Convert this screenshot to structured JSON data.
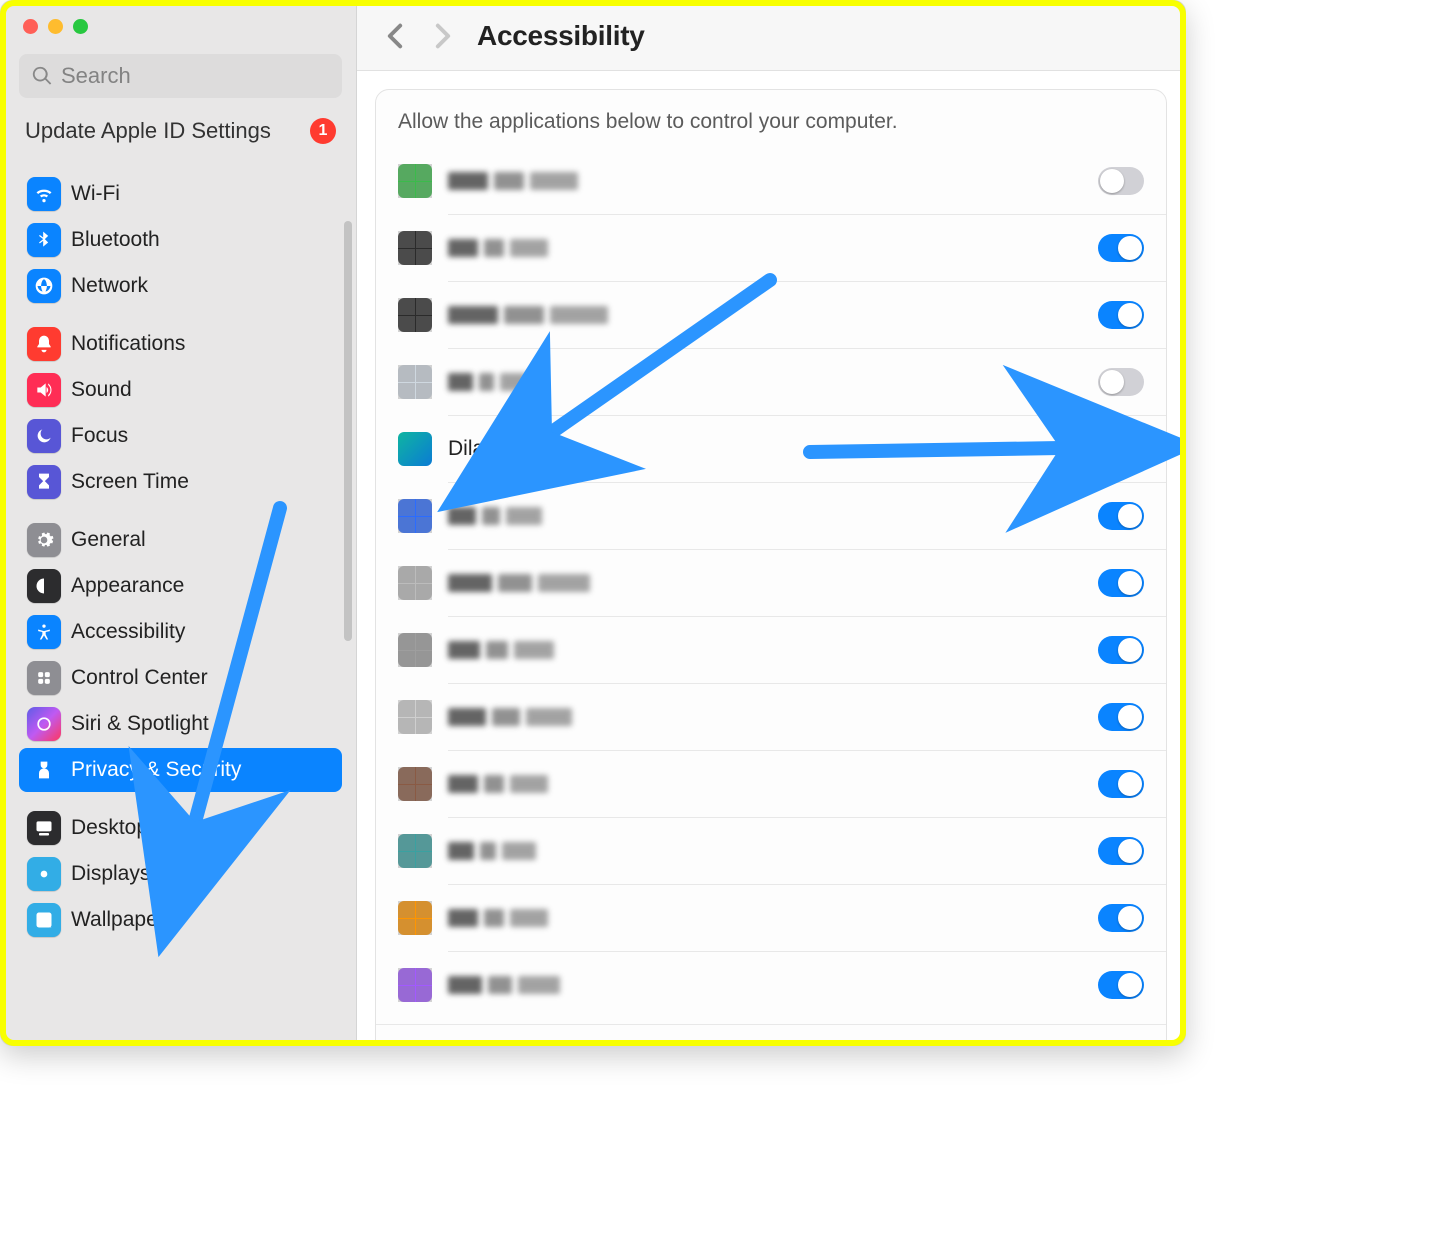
{
  "title": "Accessibility",
  "search": {
    "placeholder": "Search"
  },
  "apple_id": {
    "label": "Update Apple ID Settings",
    "badge": "1"
  },
  "sidebar": {
    "group1": [
      {
        "label": "Wi-Fi",
        "icon": "wifi",
        "color": "ib-blue"
      },
      {
        "label": "Bluetooth",
        "icon": "bluetooth",
        "color": "ib-blue"
      },
      {
        "label": "Network",
        "icon": "network",
        "color": "ib-blue"
      }
    ],
    "group2": [
      {
        "label": "Notifications",
        "icon": "bell",
        "color": "ib-red"
      },
      {
        "label": "Sound",
        "icon": "sound",
        "color": "ib-pink"
      },
      {
        "label": "Focus",
        "icon": "moon",
        "color": "ib-purple"
      },
      {
        "label": "Screen Time",
        "icon": "hourglass",
        "color": "ib-purple"
      }
    ],
    "group3": [
      {
        "label": "General",
        "icon": "gear",
        "color": "ib-grey"
      },
      {
        "label": "Appearance",
        "icon": "appearance",
        "color": "ib-dark"
      },
      {
        "label": "Accessibility",
        "icon": "accessibility",
        "color": "ib-blue"
      },
      {
        "label": "Control Center",
        "icon": "control",
        "color": "ib-grey"
      },
      {
        "label": "Siri & Spotlight",
        "icon": "siri",
        "color": "ib-siri"
      },
      {
        "label": "Privacy & Security",
        "icon": "privacy",
        "color": "ib-blue",
        "selected": true
      }
    ],
    "group4": [
      {
        "label": "Desktop & Dock",
        "icon": "dock",
        "color": "ib-dark"
      },
      {
        "label": "Displays",
        "icon": "displays",
        "color": "ib-lblue"
      },
      {
        "label": "Wallpaper",
        "icon": "wallpaper",
        "color": "ib-lblue"
      }
    ]
  },
  "section_label": "Allow the applications below to control your computer.",
  "apps": [
    {
      "name_hidden": true,
      "on": false
    },
    {
      "name_hidden": true,
      "on": true
    },
    {
      "name_hidden": true,
      "on": true
    },
    {
      "name_hidden": true,
      "on": false
    },
    {
      "name": "Dilato",
      "on": true,
      "highlight": true
    },
    {
      "name_hidden": true,
      "on": true
    },
    {
      "name_hidden": true,
      "on": true
    },
    {
      "name_hidden": true,
      "on": true
    },
    {
      "name_hidden": true,
      "on": true
    },
    {
      "name_hidden": true,
      "on": true
    },
    {
      "name_hidden": true,
      "on": true
    },
    {
      "name_hidden": true,
      "on": true
    },
    {
      "name_hidden": true,
      "on": true
    }
  ],
  "add_remove": {
    "add": "+",
    "remove": "−"
  }
}
